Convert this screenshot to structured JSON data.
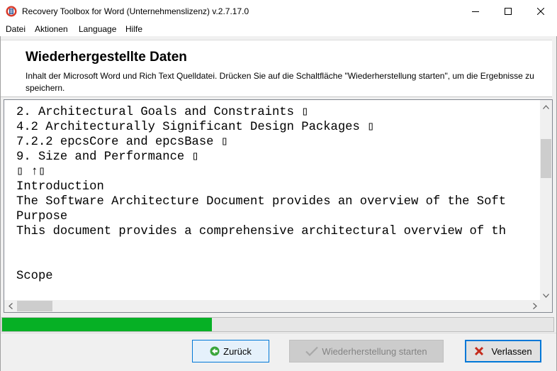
{
  "window": {
    "title": "Recovery Toolbox for Word (Unternehmenslizenz) v.2.7.17.0",
    "app_icon": "recovery-toolbox-word-icon",
    "controls": [
      "minimize-icon",
      "maximize-icon",
      "close-icon"
    ]
  },
  "menu": {
    "items": [
      "Datei",
      "Aktionen",
      "Language",
      "Hilfe"
    ]
  },
  "header": {
    "title": "Wiederhergestellte Daten",
    "description": "Inhalt der Microsoft Word und Rich Text Quelldatei. Drücken Sie auf die Schaltfläche \"Wiederherstellung starten\", um die Ergebnisse zu speichern."
  },
  "viewer": {
    "lines": [
      "2. Architectural Goals and Constraints ▯",
      "4.2 Architecturally Significant Design Packages ▯",
      "7.2.2 epcsCore and epcsBase ▯",
      "9. Size and Performance ▯",
      "▯ ↑▯",
      "Introduction",
      "The Software Architecture Document provides an overview of the Soft",
      "Purpose",
      "This document provides a comprehensive architectural overview of th",
      "",
      "",
      "Scope"
    ],
    "vertical_scroll_position": 0.2,
    "horizontal_scroll_position": 0.0
  },
  "progress": {
    "value_fraction": 0.38,
    "color": "#06b025"
  },
  "buttons": {
    "back_label": "Zurück",
    "back_icon": "arrow-left-circle-icon",
    "start_label": "Wiederherstellung starten",
    "start_icon": "checkmark-icon",
    "exit_label": "Verlassen",
    "exit_icon": "red-x-icon"
  },
  "colors": {
    "accent": "#0078d7",
    "exit_icon_red": "#c42b1c",
    "back_icon_green": "#3aa53a"
  }
}
